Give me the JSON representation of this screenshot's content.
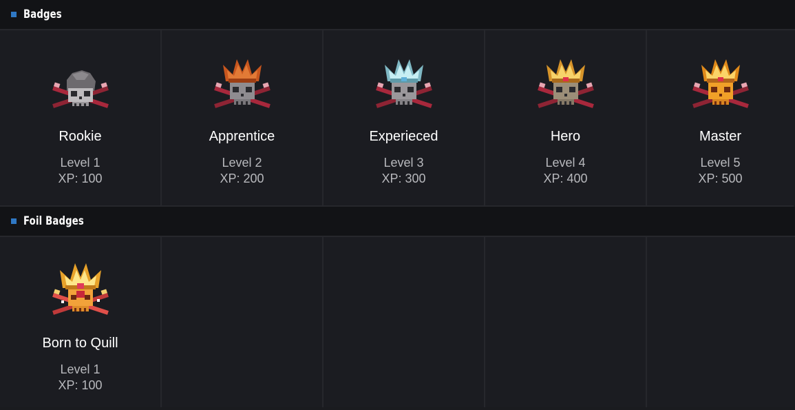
{
  "sections": [
    {
      "title": "Badges",
      "items": [
        {
          "name": "Rookie",
          "level": "Level 1",
          "xp": "XP: 100",
          "crown": "none"
        },
        {
          "name": "Apprentice",
          "level": "Level 2",
          "xp": "XP: 200",
          "crown": "#d0662a"
        },
        {
          "name": "Experieced",
          "level": "Level 3",
          "xp": "XP: 300",
          "crown": "#a9d6de"
        },
        {
          "name": "Hero",
          "level": "Level 4",
          "xp": "XP: 400",
          "crown": "#f0b640"
        },
        {
          "name": "Master",
          "level": "Level 5",
          "xp": "XP: 500",
          "crown": "#f4b033"
        }
      ]
    },
    {
      "title": "Foil Badges",
      "items": [
        {
          "name": "Born to Quill",
          "level": "Level 1",
          "xp": "XP: 100",
          "crown": "#f4b033"
        }
      ]
    }
  ],
  "colors": {
    "accent": "#2f78c4",
    "background": "#1b1c21",
    "header": "#121316",
    "divider": "#26272c"
  }
}
